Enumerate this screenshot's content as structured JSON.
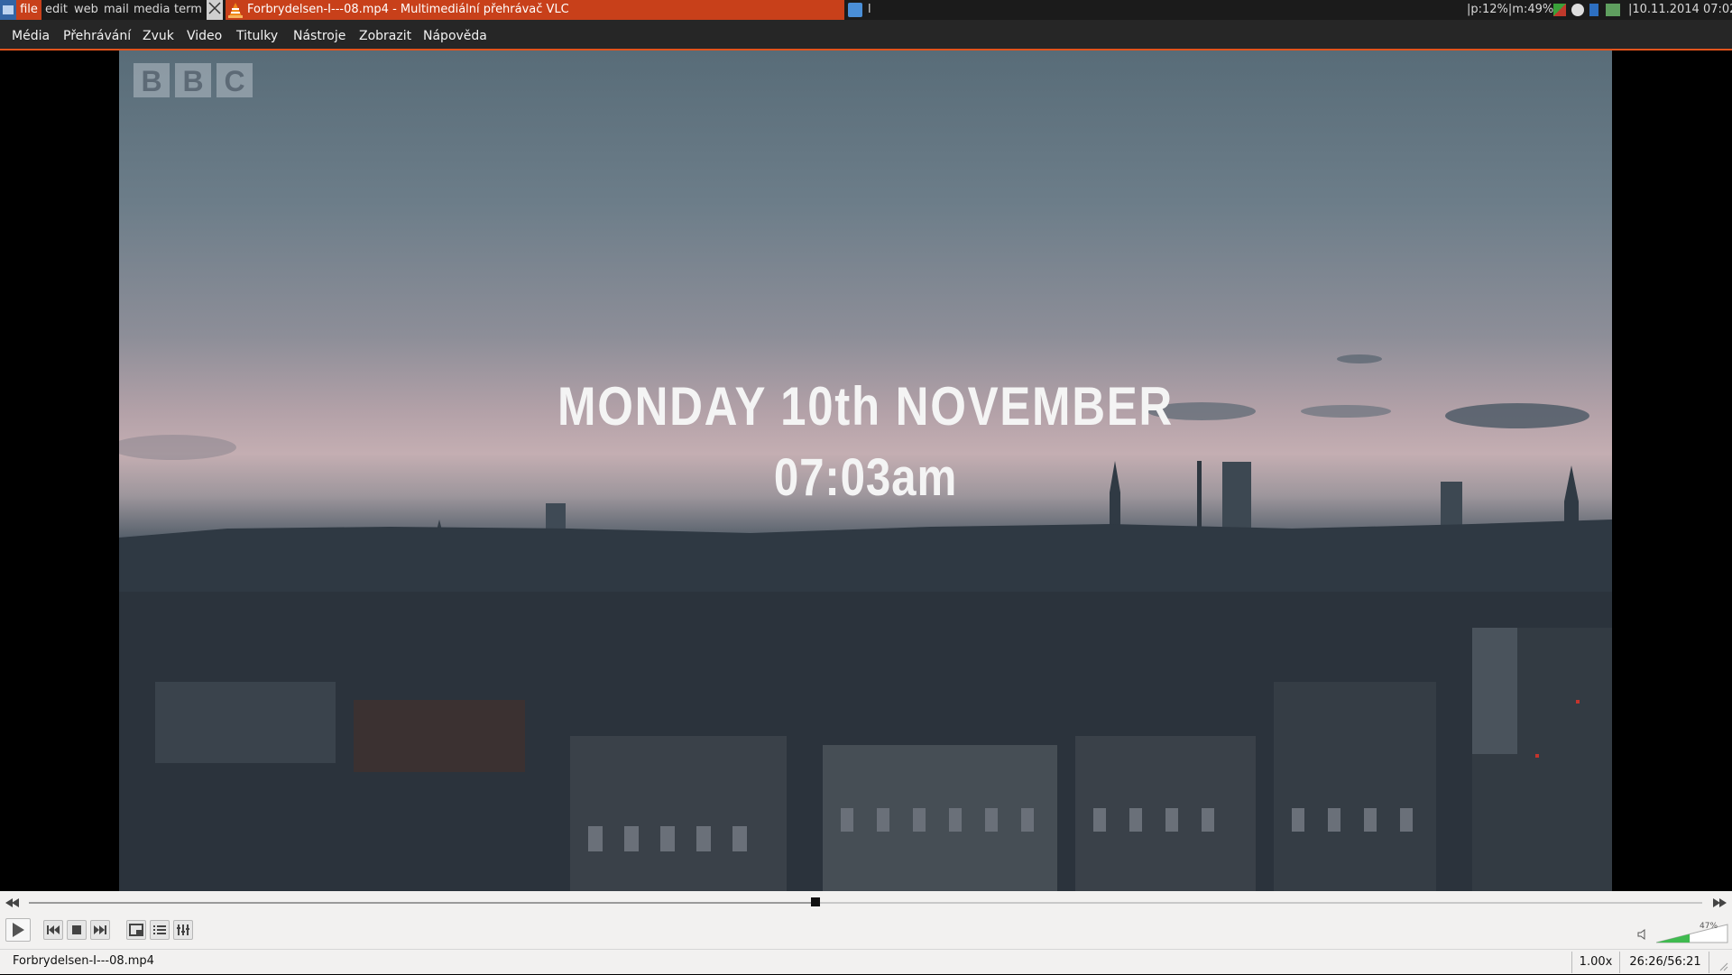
{
  "taskbar": {
    "workspaces": [
      "file",
      "edit",
      "web",
      "mail",
      "media",
      "term"
    ],
    "active_window_title": "Forbrydelsen-I---08.mp4 - Multimediální přehrávač VLC",
    "secondary_window_title": "l",
    "stats": "|p:12%|m:49%|",
    "clock": "|10.11.2014 07:02"
  },
  "menu": [
    "Média",
    "Přehrávání",
    "Zvuk",
    "Video",
    "Titulky",
    "Nástroje",
    "Zobrazit",
    "Nápověda"
  ],
  "video": {
    "channel_logo_letters": [
      "B",
      "B",
      "C"
    ],
    "caption_line1": "MONDAY 10th NOVEMBER",
    "caption_line2": "07:03am"
  },
  "player": {
    "seek_position": 0.47,
    "volume_percent": "47%",
    "volume_level": 0.47,
    "icons": [
      "play-icon",
      "previous-icon",
      "stop-icon",
      "next-icon",
      "fullscreen-icon",
      "playlist-icon",
      "extended-settings-icon",
      "speaker-icon"
    ],
    "status_file": "Forbrydelsen-I---08.mp4",
    "speed": "1.00x",
    "time": "26:26/56:21"
  },
  "colors": {
    "accent": "#e2531c",
    "active_task": "#c8401a",
    "taskbar_bg": "#1b1b1b",
    "menubar_bg": "#262626",
    "controls_bg": "#f2f1f0"
  }
}
